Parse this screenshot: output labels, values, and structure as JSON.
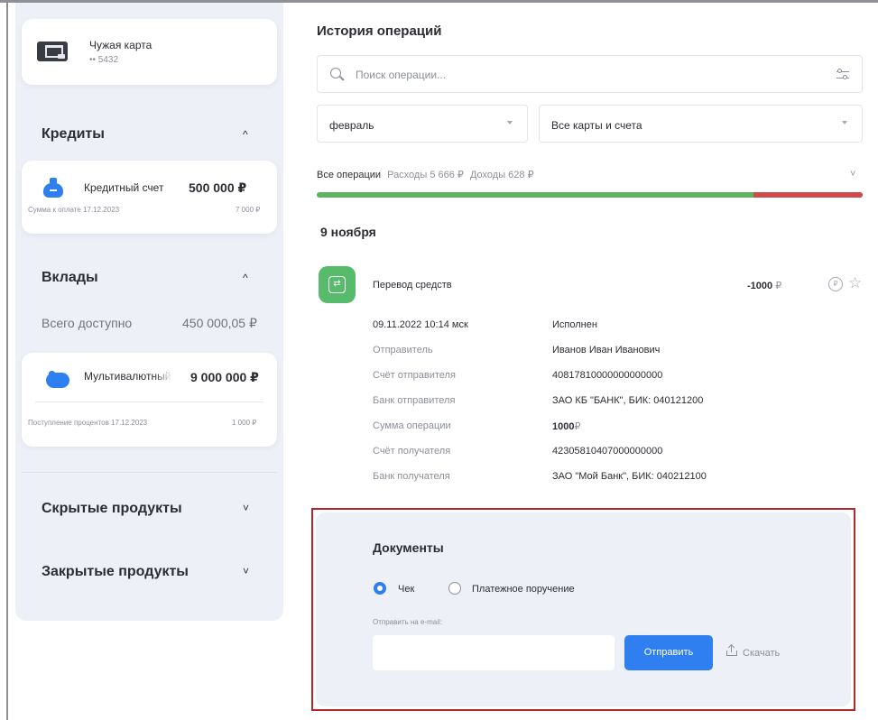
{
  "sidebar": {
    "foreign_card": {
      "title": "Чужая карта",
      "number": "•• 5432"
    },
    "credits": {
      "heading": "Кредиты",
      "toggle": "^",
      "account": {
        "name": "Кредитный счет",
        "amount": "500 000 ₽",
        "due_label": "Сумма к оплате 17.12.2023",
        "due_amount": "7 000 ₽"
      }
    },
    "deposits": {
      "heading": "Вклады",
      "toggle": "^",
      "total_label": "Всего доступно",
      "total_amount": "450 000,05 ₽",
      "account": {
        "name": "Мультивалютный вклад",
        "amount": "9 000 000 ₽",
        "interest_label": "Поступление процентов 17.12.2023",
        "interest_amount": "1 000 ₽"
      }
    },
    "hidden": {
      "heading": "Скрытые продукты",
      "toggle": "˅"
    },
    "closed": {
      "heading": "Закрытые продукты",
      "toggle": "˅"
    }
  },
  "main": {
    "title": "История операций",
    "search_placeholder": "Поиск операции...",
    "period_select": "февраль",
    "cards_select": "Все карты и счета",
    "ops_tabs": {
      "all": "Все операции",
      "expenses": "Расходы 5 666 ₽",
      "income": "Доходы 628 ₽",
      "chevron": "˅"
    },
    "expense_bar": {
      "expense_fraction": 0.8
    },
    "date_group": "9 ноября",
    "operation": {
      "icon_glyph": "⇄",
      "name": "Перевод средств",
      "amount": "-1000",
      "currency": "₽",
      "ruble_badge": "₽",
      "star": "☆",
      "details": {
        "datetime": "09.11.2022 10:14 мск",
        "status": "Исполнен",
        "sender_label": "Отправитель",
        "sender": "Иванов Иван Иванович",
        "sender_account_label": "Счёт отправителя",
        "sender_account": "40817810000000000000",
        "sender_bank_label": "Банк отправителя",
        "sender_bank": "ЗАО КБ \"БАНК\", БИК: 040121200",
        "sum_label": "Сумма операции",
        "sum": "1000",
        "sum_currency": "₽",
        "recipient_account_label": "Счёт получателя",
        "recipient_account": "42305810407000000000",
        "recipient_bank_label": "Банк получателя",
        "recipient_bank": "ЗАО \"Мой Банк\", БИК: 040212100"
      }
    },
    "documents": {
      "heading": "Документы",
      "option_receipt": "Чек",
      "option_order": "Платежное поручение",
      "selected": "Чек",
      "email_label": "Отправить на e-mail:",
      "email_value": "",
      "send_button": "Отправить",
      "download": "Скачать"
    }
  }
}
